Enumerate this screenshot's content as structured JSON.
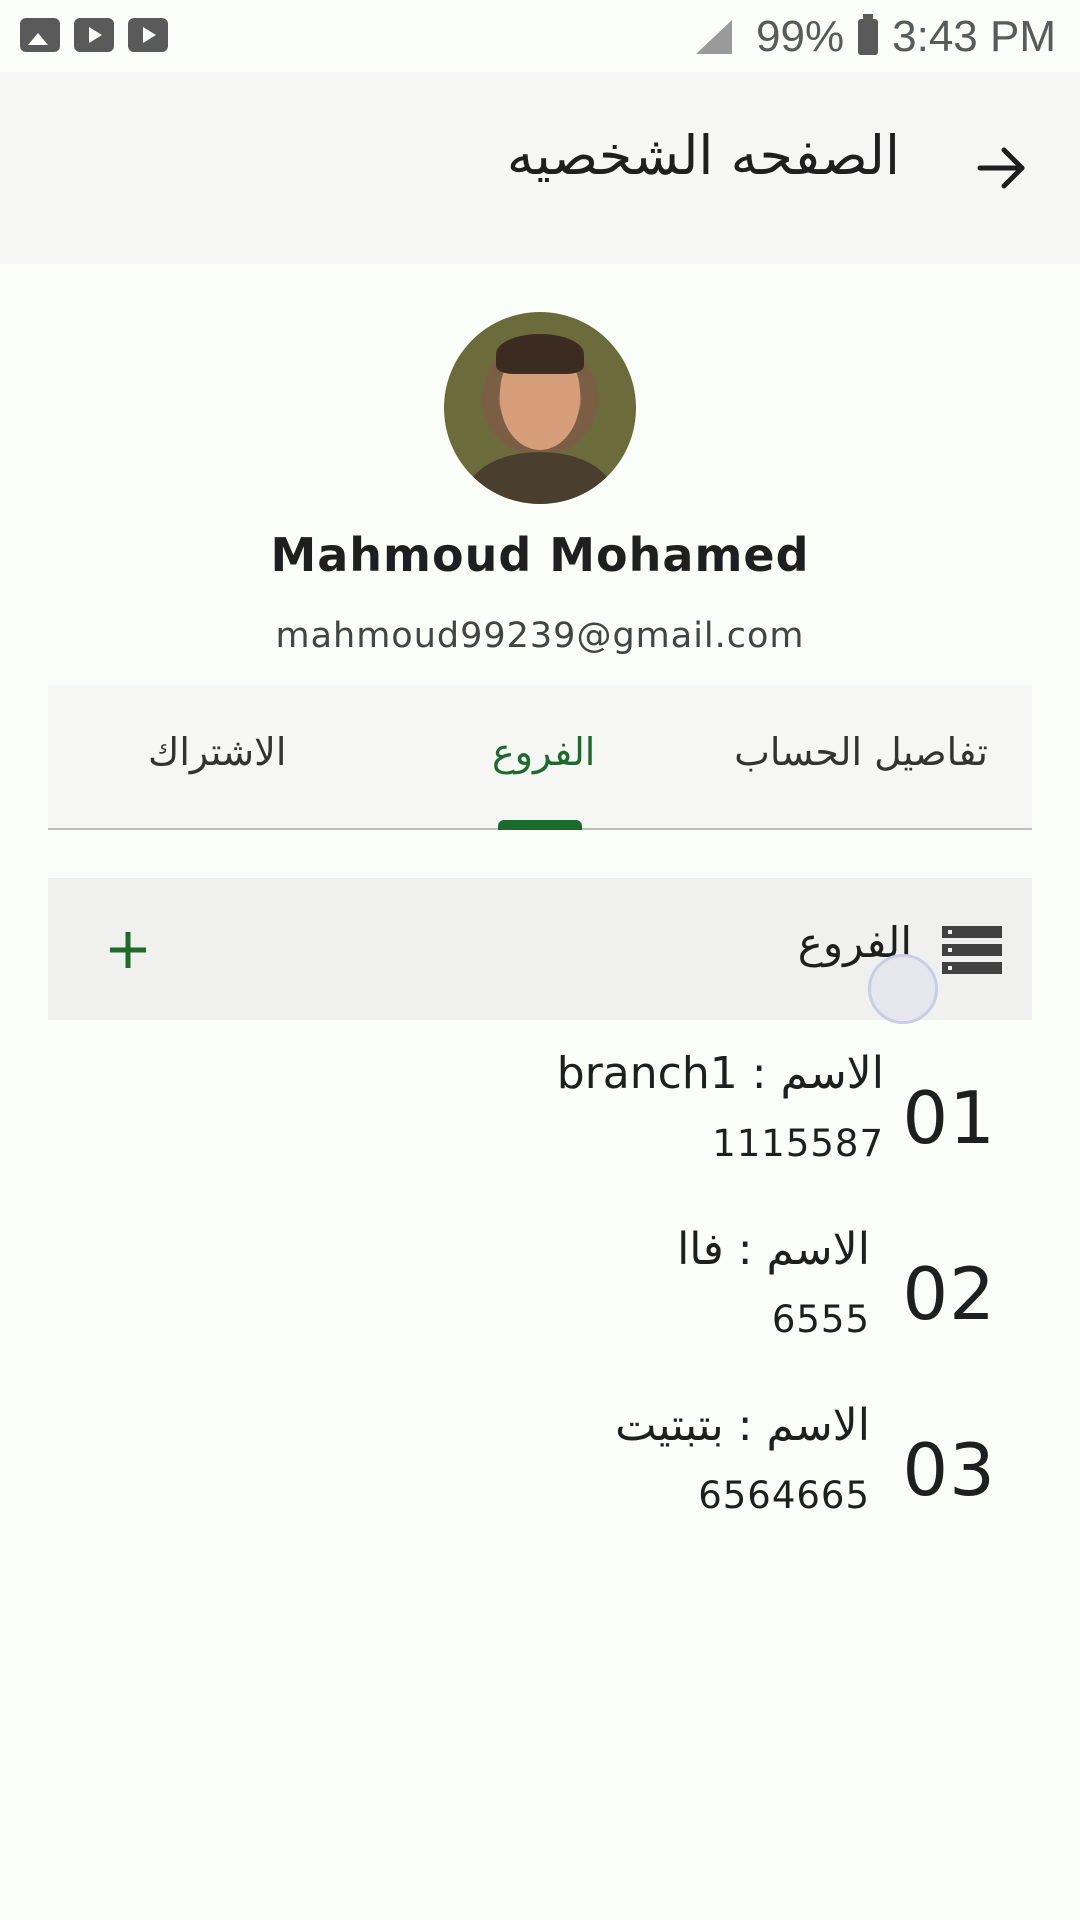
{
  "status_bar": {
    "battery": "99%",
    "time": "3:43 PM",
    "icons": [
      "image-icon",
      "youtube-icon",
      "youtube-icon",
      "signal-icon",
      "battery-icon"
    ]
  },
  "app_bar": {
    "title": "الصفحه الشخصيه",
    "back_icon": "arrow-right-icon"
  },
  "profile": {
    "name": "Mahmoud Mohamed",
    "email": "mahmoud99239@gmail.com"
  },
  "tabs": [
    {
      "label": "تفاصيل الحساب",
      "active": false
    },
    {
      "label": "الفروع",
      "active": true
    },
    {
      "label": "الاشتراك",
      "active": false
    }
  ],
  "section": {
    "title": "الفروع",
    "list_icon": "list-icon",
    "add_icon": "plus-icon",
    "add_label": "+"
  },
  "branches": [
    {
      "number": "01",
      "name": "الاسم : branch1",
      "code": "1115587"
    },
    {
      "number": "02",
      "name": "الاسم : فاا",
      "code": "6555"
    },
    {
      "number": "03",
      "name": "الاسم : بتبتيت",
      "code": "6564665"
    }
  ],
  "colors": {
    "accent": "#1d6b2c",
    "background": "#fbfdf8",
    "header_bg": "#f6f6f4"
  }
}
